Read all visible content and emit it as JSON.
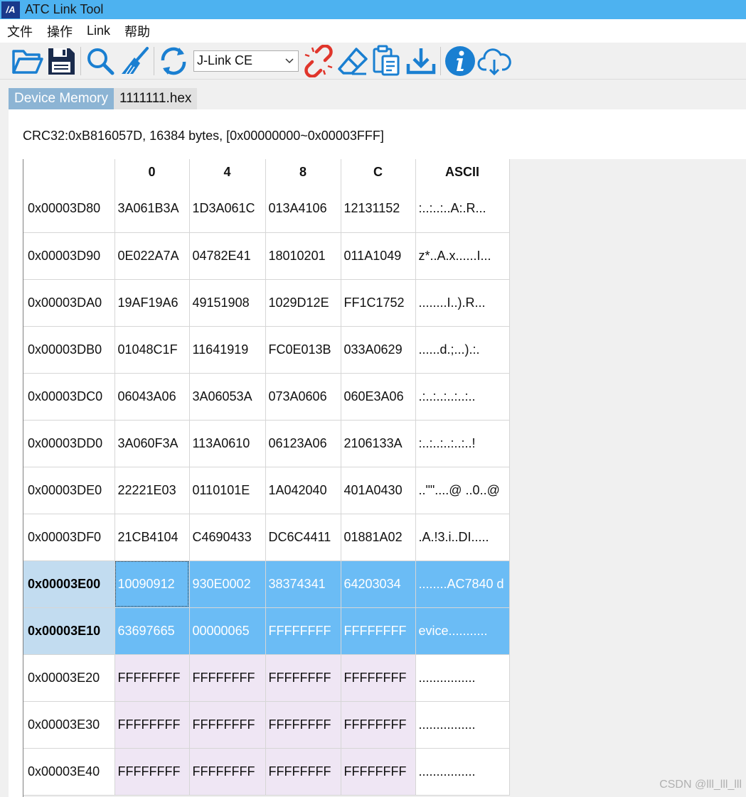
{
  "window": {
    "title": "ATC Link Tool",
    "logo_text": "/A"
  },
  "menu": [
    "文件",
    "操作",
    "Link",
    "帮助"
  ],
  "toolbar": {
    "probe": "J-Link CE"
  },
  "tabs": [
    "Device Memory",
    "1111111.hex"
  ],
  "info": "CRC32:0xB816057D, 16384 bytes, [0x00000000~0x00003FFF]",
  "table": {
    "headers": [
      "",
      "0",
      "4",
      "8",
      "C",
      "ASCII"
    ],
    "rows": [
      {
        "addr": "0x00003D80",
        "cells": [
          "3A061B3A",
          "1D3A061C",
          "013A4106",
          "12131152"
        ],
        "ascii": ":..:..:..A:.R..."
      },
      {
        "addr": "0x00003D90",
        "cells": [
          "0E022A7A",
          "04782E41",
          "18010201",
          "011A1049"
        ],
        "ascii": "z*..A.x......I..."
      },
      {
        "addr": "0x00003DA0",
        "cells": [
          "19AF19A6",
          "49151908",
          "1029D12E",
          "FF1C1752"
        ],
        "ascii": "........I..).R..."
      },
      {
        "addr": "0x00003DB0",
        "cells": [
          "01048C1F",
          "11641919",
          "FC0E013B",
          "033A0629"
        ],
        "ascii": "......d.;...).:."
      },
      {
        "addr": "0x00003DC0",
        "cells": [
          "06043A06",
          "3A06053A",
          "073A0606",
          "060E3A06"
        ],
        "ascii": ".:..:..:..:..:.."
      },
      {
        "addr": "0x00003DD0",
        "cells": [
          "3A060F3A",
          "113A0610",
          "06123A06",
          "2106133A"
        ],
        "ascii": ":..:..:..:..:..!"
      },
      {
        "addr": "0x00003DE0",
        "cells": [
          "22221E03",
          "0110101E",
          "1A042040",
          "401A0430"
        ],
        "ascii": "..\"\"....@ ..0..@"
      },
      {
        "addr": "0x00003DF0",
        "cells": [
          "21CB4104",
          "C4690433",
          "DC6C4411",
          "01881A02"
        ],
        "ascii": ".A.!3.i..DI....."
      },
      {
        "addr": "0x00003E00",
        "cells": [
          "10090912",
          "930E0002",
          "38374341",
          "64203034"
        ],
        "ascii": "........AC7840 d"
      },
      {
        "addr": "0x00003E10",
        "cells": [
          "63697665",
          "00000065",
          "FFFFFFFF",
          "FFFFFFFF"
        ],
        "ascii": "evice..........."
      },
      {
        "addr": "0x00003E20",
        "cells": [
          "FFFFFFFF",
          "FFFFFFFF",
          "FFFFFFFF",
          "FFFFFFFF"
        ],
        "ascii": "................"
      },
      {
        "addr": "0x00003E30",
        "cells": [
          "FFFFFFFF",
          "FFFFFFFF",
          "FFFFFFFF",
          "FFFFFFFF"
        ],
        "ascii": "................"
      },
      {
        "addr": "0x00003E40",
        "cells": [
          "FFFFFFFF",
          "FFFFFFFF",
          "FFFFFFFF",
          "FFFFFFFF"
        ],
        "ascii": "................"
      }
    ]
  },
  "watermark": "CSDN @lll_lll_lll",
  "colors": {
    "titlebar": "#4db2f0",
    "selection": "#6bbcf5",
    "ff_fill": "#efe6f4",
    "tab_active": "#8cb4d4",
    "icon_blue": "#1a7fd1",
    "icon_red": "#e0352b"
  },
  "icons": [
    "open-folder-icon",
    "save-icon",
    "search-icon",
    "clean-brush-icon",
    "refresh-icon",
    "disconnect-icon",
    "erase-icon",
    "paste-clipboard-icon",
    "download-icon",
    "info-icon",
    "cloud-download-icon"
  ]
}
